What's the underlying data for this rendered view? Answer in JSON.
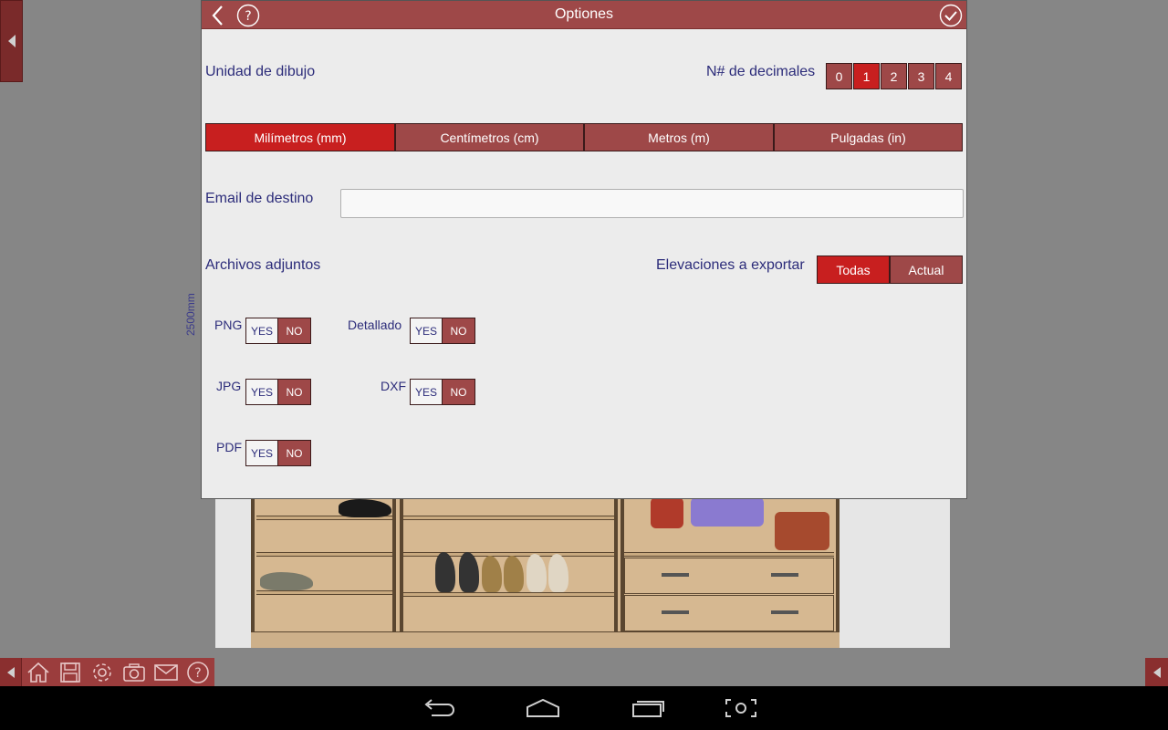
{
  "background": {
    "dimension_label": "2500mm"
  },
  "dialog": {
    "title": "Optiones",
    "drawing_unit_label": "Unidad de dibujo",
    "decimals_label": "N# de decimales",
    "decimals": [
      "0",
      "1",
      "2",
      "3",
      "4"
    ],
    "decimals_selected": "1",
    "units": [
      "Milímetros (mm)",
      "Centímetros (cm)",
      "Metros (m)",
      "Pulgadas (in)"
    ],
    "units_selected": "Milímetros (mm)",
    "email_label": "Email de destino",
    "email_value": "",
    "attachments_label": "Archivos adjuntos",
    "elevations_label": "Elevaciones a exportar",
    "elevations": [
      "Todas",
      "Actual"
    ],
    "elevations_selected": "Todas",
    "toggles": {
      "png": {
        "label": "PNG",
        "yes": "YES",
        "no": "NO",
        "value": "NO"
      },
      "jpg": {
        "label": "JPG",
        "yes": "YES",
        "no": "NO",
        "value": "NO"
      },
      "pdf": {
        "label": "PDF",
        "yes": "YES",
        "no": "NO",
        "value": "NO"
      },
      "detallado": {
        "label": "Detallado",
        "yes": "YES",
        "no": "NO",
        "value": "NO"
      },
      "dxf": {
        "label": "DXF",
        "yes": "YES",
        "no": "NO",
        "value": "NO"
      }
    }
  },
  "toolbar": {
    "icons": [
      "home-icon",
      "save-icon",
      "gear-icon",
      "camera-icon",
      "mail-icon",
      "help-icon"
    ]
  },
  "colors": {
    "accent": "#9e4848",
    "active": "#c81f1f",
    "label_text": "#2c2c7a"
  }
}
